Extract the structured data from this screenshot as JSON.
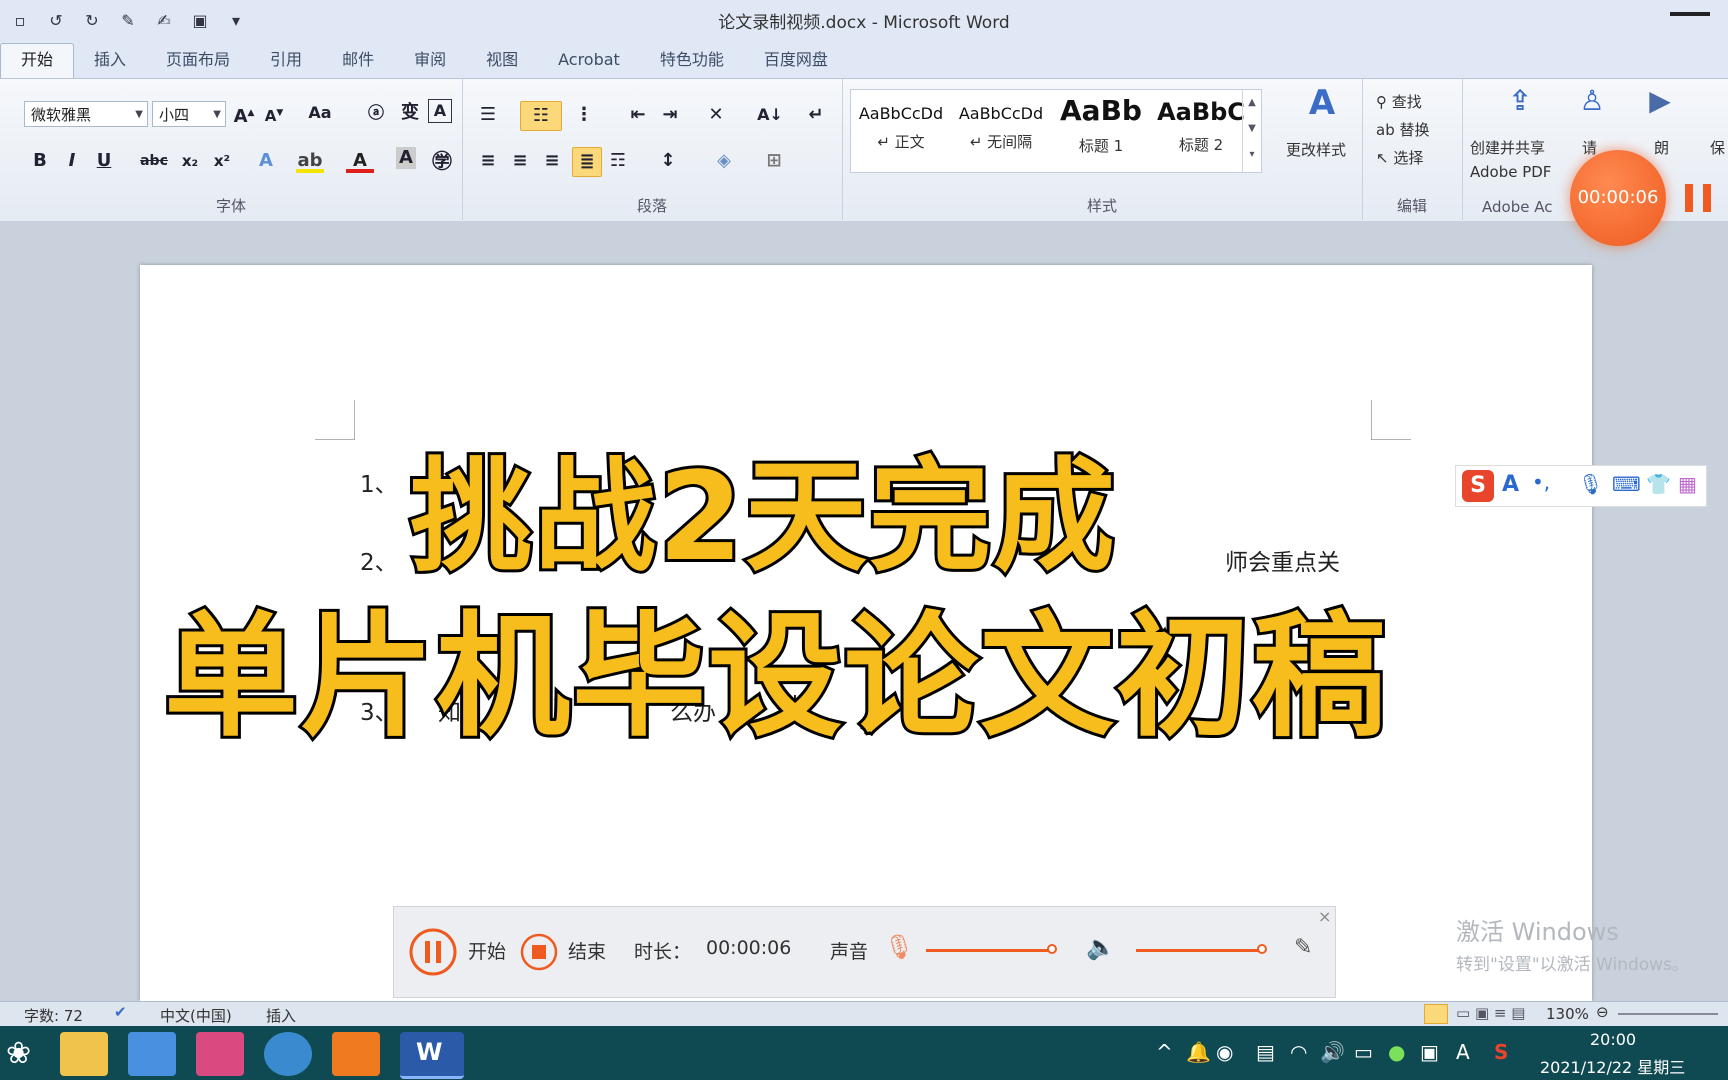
{
  "window": {
    "title": "论文录制视频.docx - Microsoft Word"
  },
  "tabs": [
    {
      "label": "开始",
      "active": true
    },
    {
      "label": "插入"
    },
    {
      "label": "页面布局"
    },
    {
      "label": "引用"
    },
    {
      "label": "邮件"
    },
    {
      "label": "审阅"
    },
    {
      "label": "视图"
    },
    {
      "label": "Acrobat"
    },
    {
      "label": "特色功能"
    },
    {
      "label": "百度网盘"
    }
  ],
  "ribbon": {
    "font": {
      "name": "微软雅黑",
      "size": "小四",
      "group_label": "字体"
    },
    "paragraph": {
      "group_label": "段落"
    },
    "styles": {
      "group_label": "样式",
      "items": [
        {
          "preview": "AaBbCcDd",
          "name": "↵ 正文"
        },
        {
          "preview": "AaBbCcDd",
          "name": "↵ 无间隔"
        },
        {
          "preview": "AaBb",
          "name": "标题 1"
        },
        {
          "preview": "AaBbC",
          "name": "标题 2"
        }
      ],
      "change_styles": "更改样式"
    },
    "editing": {
      "group_label": "编辑",
      "find": "查找",
      "replace": "替换",
      "select": "选择"
    },
    "adobe": {
      "group_label": "Adobe Ac",
      "create_share": "创建并共享",
      "adobe_pdf": "Adobe PDF",
      "extra1": "请",
      "extra2": "朗",
      "extra3": "保"
    }
  },
  "document": {
    "lines": [
      {
        "num": "1、",
        "text": ""
      },
      {
        "num": "2、",
        "text": "师会重点关"
      },
      {
        "num": "3、",
        "text": "知"
      },
      {
        "text2": "么办"
      }
    ]
  },
  "overlay": {
    "line1": "挑战2天完成",
    "line2": "单片机毕设论文初稿"
  },
  "recorder": {
    "timer": "00:00:06",
    "start_label": "开始",
    "end_label": "结束",
    "duration_label": "时长：",
    "duration_value": "00:00:06",
    "sound_label": "声音",
    "close": "×",
    "mic_level": 0.97,
    "speaker_level": 0.97
  },
  "watermark": {
    "line1": "激活 Windows",
    "line2": "转到\"设置\"以激活 Windows。"
  },
  "statusbar": {
    "word_count": "字数: 72",
    "language": "中文(中国)",
    "mode": "插入",
    "zoom": "130%"
  },
  "taskbar": {
    "time": "20:00",
    "date": "2021/12/22 星期三",
    "ime": "A"
  },
  "colors": {
    "overlay_yellow": "#f7bd1c",
    "recorder_orange": "#ee5a20",
    "taskbar": "#0f4a52"
  }
}
